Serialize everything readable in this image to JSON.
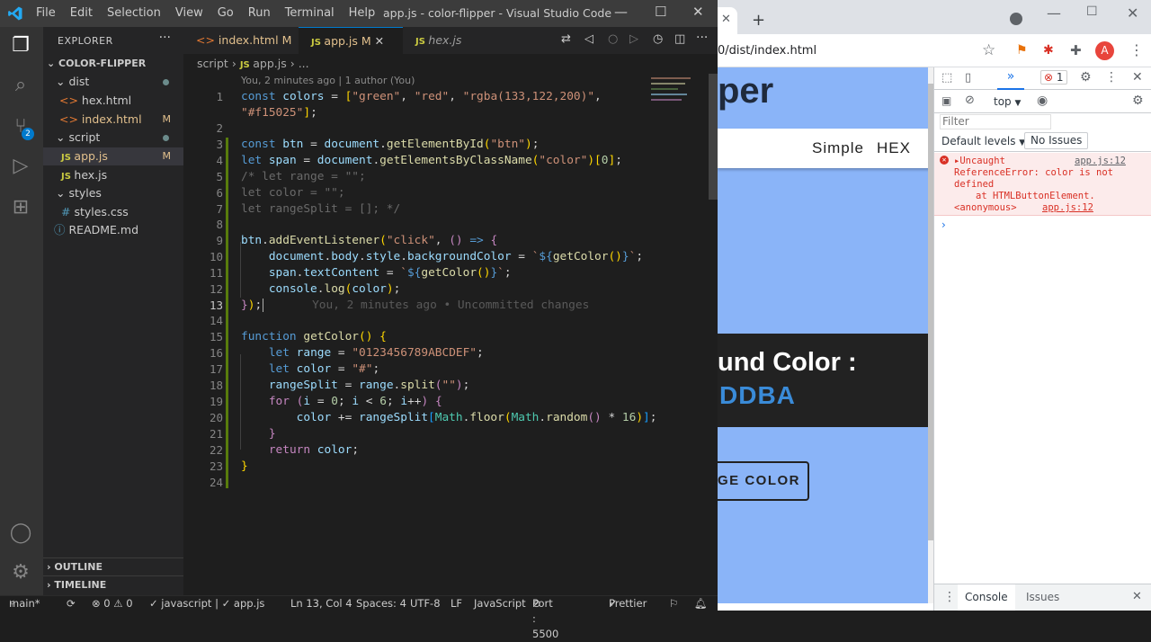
{
  "vscode": {
    "title": "app.js - color-flipper - Visual Studio Code",
    "menu": [
      "File",
      "Edit",
      "Selection",
      "View",
      "Go",
      "Run",
      "Terminal",
      "Help"
    ],
    "explorer_label": "EXPLORER",
    "scm_badge": "2",
    "tree": [
      {
        "label": "COLOR-FLIPPER",
        "kind": "root"
      },
      {
        "label": "dist",
        "kind": "folder",
        "mark": "dot"
      },
      {
        "label": "hex.html",
        "kind": "html",
        "mark": ""
      },
      {
        "label": "index.html",
        "kind": "html",
        "mark": "M"
      },
      {
        "label": "script",
        "kind": "folder",
        "mark": "dot"
      },
      {
        "label": "app.js",
        "kind": "js",
        "mark": "M"
      },
      {
        "label": "hex.js",
        "kind": "js",
        "mark": ""
      },
      {
        "label": "styles",
        "kind": "folder",
        "mark": ""
      },
      {
        "label": "styles.css",
        "kind": "css",
        "mark": ""
      },
      {
        "label": "README.md",
        "kind": "info",
        "mark": ""
      }
    ],
    "outline_label": "OUTLINE",
    "timeline_label": "TIMELINE",
    "tabs": [
      {
        "label": "index.html",
        "mark": "M"
      },
      {
        "label": "app.js",
        "mark": "M"
      },
      {
        "label": "hex.js",
        "mark": ""
      }
    ],
    "breadcrumb": [
      "script",
      "app.js",
      "..."
    ],
    "blame": "You, 2 minutes ago | 1 author (You)",
    "inline_blame": "You, 2 minutes ago • Uncommitted changes",
    "line_numbers": [
      "1",
      "2",
      "3",
      "4",
      "5",
      "6",
      "7",
      "8",
      "9",
      "10",
      "11",
      "12",
      "13",
      "14",
      "15",
      "16",
      "17",
      "18",
      "19",
      "20",
      "21",
      "22",
      "23",
      "24"
    ],
    "status": {
      "branch": "main*",
      "problems": "⊗ 0 ⚠ 0",
      "lang_check": "✓ javascript | ✓ app.js",
      "position": "Ln 13, Col 4",
      "spaces": "Spaces: 4",
      "encoding": "UTF-8",
      "eol": "LF",
      "language": "JavaScript",
      "port": "Port : 5500",
      "prettier": "Prettier"
    }
  },
  "browser": {
    "url_fragment": "0/dist/index.html",
    "page": {
      "heading_fragment": "per",
      "nav": [
        "Simple",
        "HEX"
      ],
      "bg_label_fragment": "und Color :",
      "bg_value_fragment": "DDBA",
      "button_fragment": "GE COLOR"
    },
    "devtools": {
      "context": "top",
      "filter_placeholder": "Filter",
      "levels": "Default levels",
      "issues_btn": "No Issues",
      "error_count": "1",
      "error_title": "Uncaught",
      "error_link": "app.js:12",
      "error_body": "ReferenceError: color is not defined",
      "error_stack": "at HTMLButtonElement.",
      "error_anon": "<anonymous>",
      "error_anon_link": "app.js:12",
      "drawer_tabs": [
        "Console",
        "Issues"
      ]
    }
  },
  "colors": {
    "page_bg": "#8ab4f8",
    "accent": "#007acc",
    "error": "#d93025"
  }
}
